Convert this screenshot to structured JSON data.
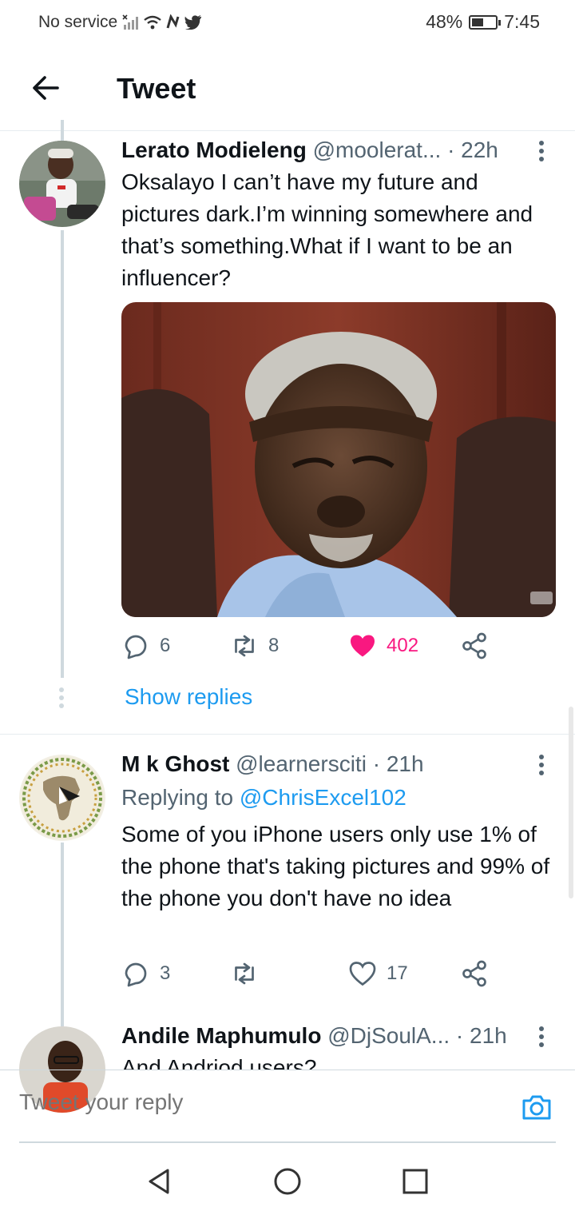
{
  "status_bar": {
    "carrier": "No service",
    "battery_percent": "48%",
    "battery_level": 0.48,
    "time": "7:45"
  },
  "header": {
    "title": "Tweet"
  },
  "tweets": [
    {
      "name": "Lerato Modieleng",
      "handle": "@moolerat...",
      "time": "· 22h",
      "text": "Oksalayo I can’t have my future and pictures dark.I’m winning somewhere and that’s something.What if I want to be an influencer?",
      "replies": "6",
      "retweets": "8",
      "likes": "402",
      "liked": true,
      "show_replies": "Show replies"
    },
    {
      "name": "M k Ghost",
      "handle": "@learnersciti",
      "time": "· 21h",
      "replying_prefix": "Replying to",
      "replying_handle": "@ChrisExcel102",
      "text": "Some of you iPhone  users  only use  1% of the phone  that's taking pictures and 99% of the phone  you don't have no idea",
      "replies": "3",
      "retweets": "",
      "likes": "17",
      "liked": false
    },
    {
      "name": "Andile Maphumulo",
      "handle": "@DjSoulA...",
      "time": "· 21h",
      "text": "And Andriod users?"
    }
  ],
  "reply_box": {
    "placeholder": "Tweet your reply"
  },
  "colors": {
    "accent": "#1d9bf0",
    "like": "#f91880",
    "text": "#0f1419",
    "muted": "#536471"
  }
}
